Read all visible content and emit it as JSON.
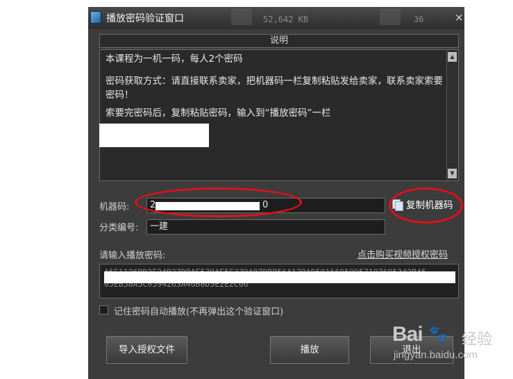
{
  "window": {
    "title": "播放密码验证窗口",
    "close_symbol": "×",
    "background_file_size": "52,642 KB",
    "background_number": "36"
  },
  "description": {
    "header": "说明",
    "lines": [
      "本课程为一机一码，每人2个密码",
      "密码获取方式：请直接联系卖家，把机器码一栏复制粘贴发给卖家，联系卖家索要密码！",
      "索要完密码后，复制粘贴密码，输入到“播放密码”一栏"
    ]
  },
  "machine_code": {
    "label": "机器码:",
    "value": "2",
    "value_tail": "0",
    "copy_button": "复制机器码"
  },
  "category": {
    "label": "分类编号:",
    "value": "一建"
  },
  "password": {
    "label": "请输入播放密码:",
    "buy_link": "点击购买视频授权密码",
    "line1": "A5E1126BD2E24B27DBAE579AE5E379A07DBB56A179AD59166950957107695342B45",
    "line2": "05EB58A5C0594263A46B8D3E2E2C66"
  },
  "remember": {
    "label": "记住密码自动播放(不再弹出这个验证窗口)",
    "checked": false
  },
  "buttons": {
    "import": "导入授权文件",
    "play": "播放",
    "exit": "退出"
  },
  "watermark": {
    "brand": "Bai",
    "brand_tail": "经验",
    "url": "jingyan.baidu.com"
  },
  "colors": {
    "annotation": "#e0101a",
    "window_bg": "#3c3c3c"
  },
  "icons": [
    "app-icon",
    "copy-icon",
    "scroll-up-icon",
    "scroll-down-icon",
    "close-icon"
  ]
}
